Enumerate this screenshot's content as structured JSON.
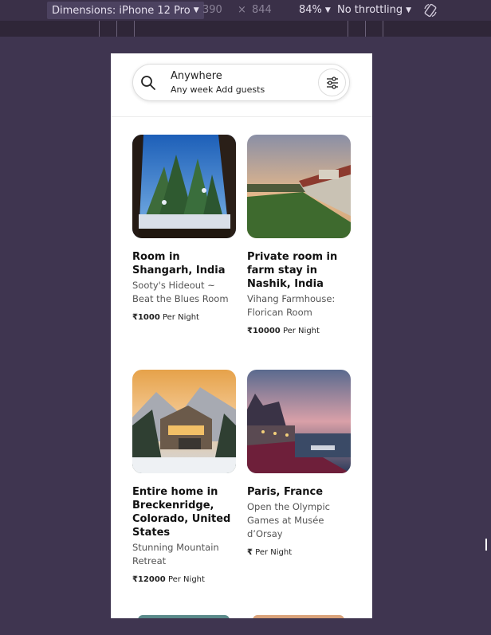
{
  "devtools": {
    "dimensions_label": "Dimensions: iPhone 12 Pro",
    "width": "390",
    "times": "×",
    "height": "844",
    "zoom": "84%",
    "throttle": "No throttling"
  },
  "search": {
    "title": "Anywhere",
    "subtitle": "Any week Add guests"
  },
  "listings": [
    {
      "title": "Room in Shangarh, India",
      "description": "Sooty's Hideout ~ Beat the Blues Room",
      "price": "₹1000",
      "price_unit": "Per Night"
    },
    {
      "title": "Private room in farm stay in Nashik, India",
      "description": "Vihang Farmhouse: Florican Room",
      "price": "₹10000",
      "price_unit": "Per Night"
    },
    {
      "title": "Entire home in Breckenridge, Colorado, United States",
      "description": "Stunning Mountain Retreat",
      "price": "₹12000",
      "price_unit": "Per Night"
    },
    {
      "title": "Paris, France",
      "description": "Open the Olympic Games at Musée d’Orsay",
      "price": "₹",
      "price_unit": "Per Night"
    }
  ],
  "colors": {
    "devtools_bg": "#3f3550",
    "viewport_bg": "#ffffff",
    "text_primary": "#111111",
    "text_secondary": "#555555"
  }
}
